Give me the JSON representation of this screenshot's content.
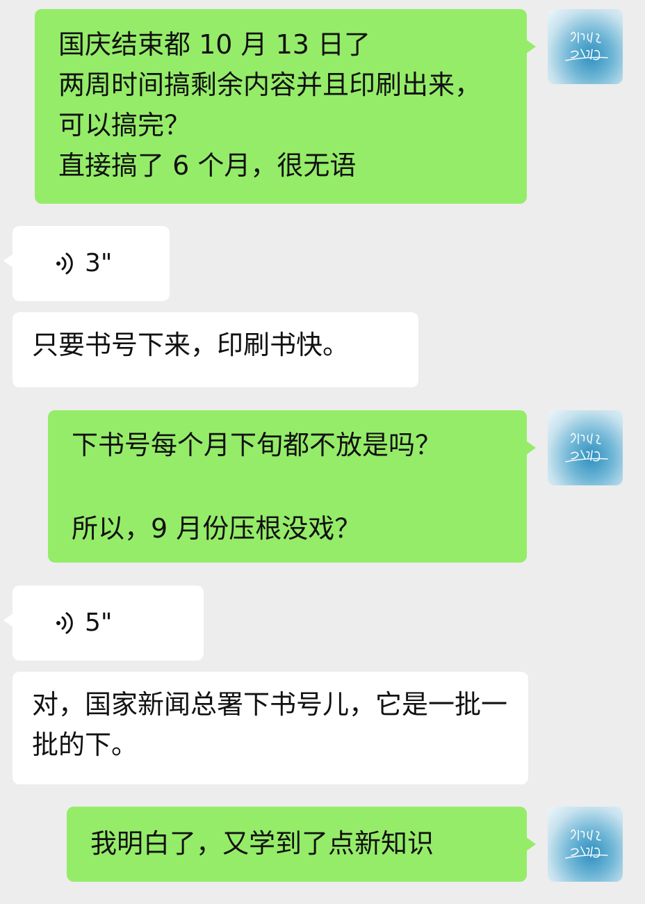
{
  "messages": [
    {
      "side": "out",
      "text": "国庆结束都 10 月 13 日了\n两周时间搞剩余内容并且印刷出来，可以搞完？\n直接搞了 6 个月，很无语"
    },
    {
      "side": "in",
      "type": "voice",
      "duration": "3\""
    },
    {
      "side": "in",
      "text": "只要书号下来，印刷书快。"
    },
    {
      "side": "out",
      "text": "下书号每个月下旬都不放是吗？\n\n所以，9 月份压根没戏？"
    },
    {
      "side": "in",
      "type": "voice",
      "duration": "5\""
    },
    {
      "side": "in",
      "text": "对，国家新闻总署下书号儿，它是一批一批的下。"
    },
    {
      "side": "out",
      "text": "我明白了，又学到了点新知识"
    }
  ],
  "avatar": {
    "icon": "avatar-calligraphy",
    "colors": {
      "center": "#2e8fbf",
      "edge": "#eef7fb"
    }
  },
  "colors": {
    "background": "#ededed",
    "outgoing_bubble": "#95ec69",
    "incoming_bubble": "#ffffff",
    "text": "#111111"
  }
}
